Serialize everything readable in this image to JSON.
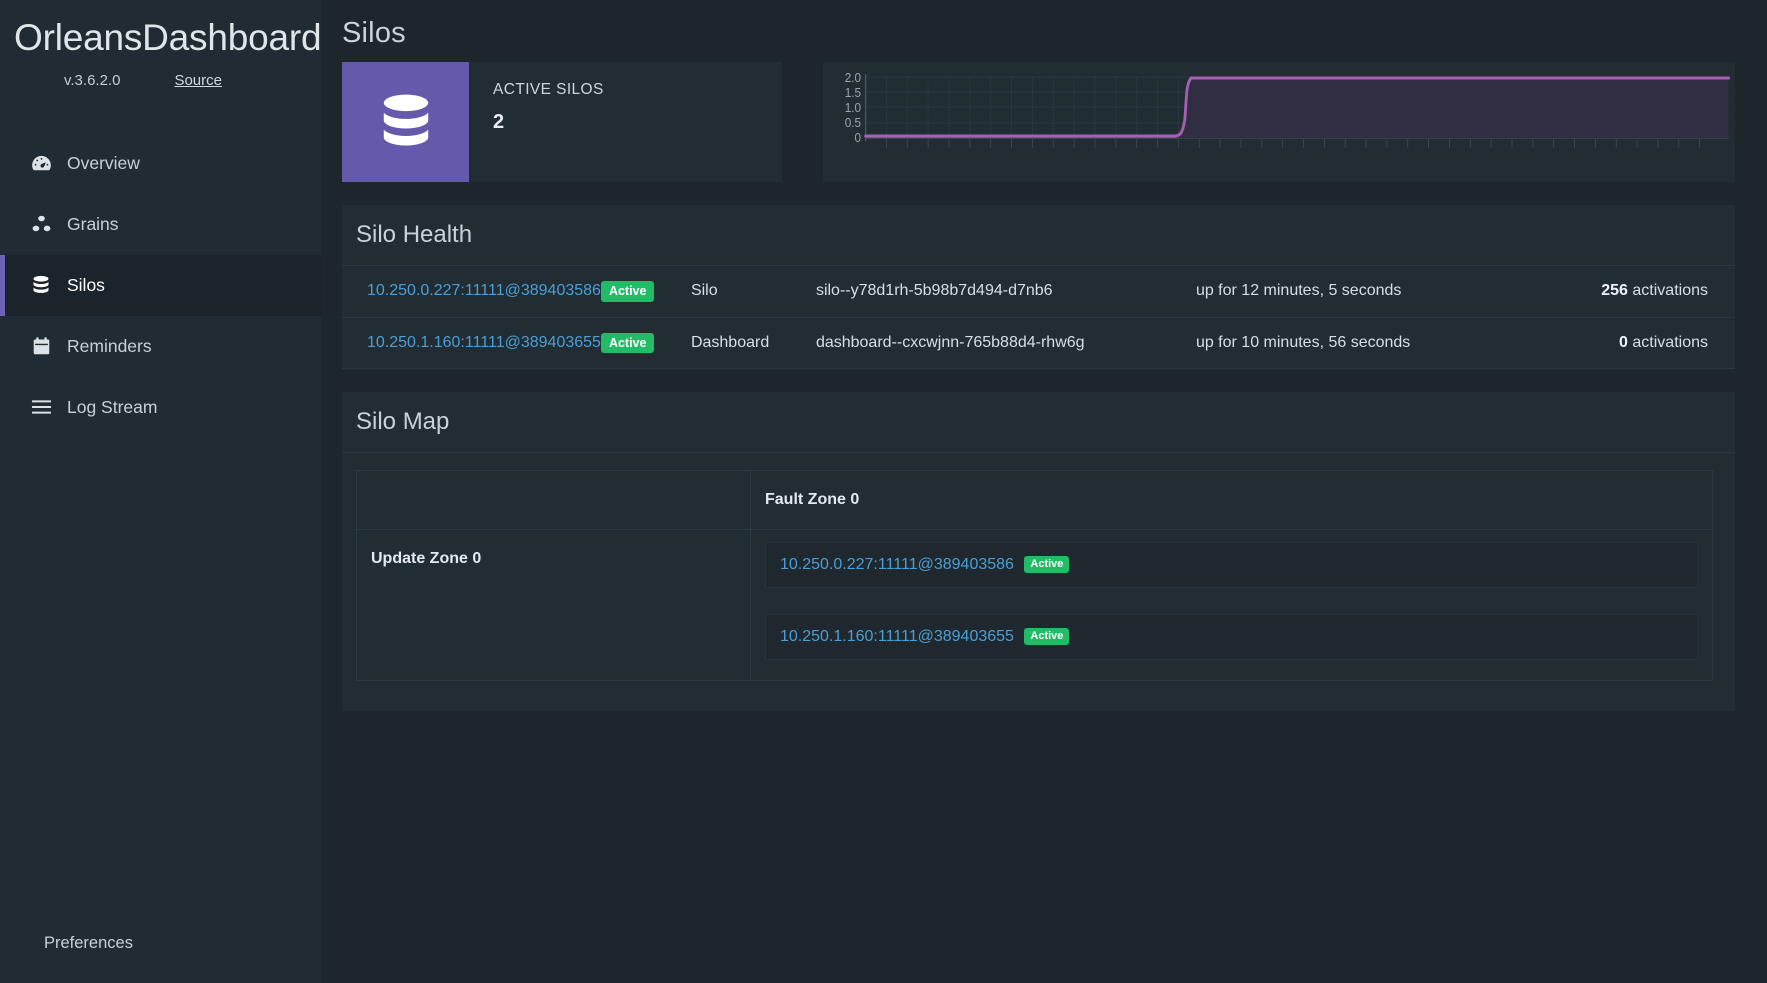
{
  "sidebar": {
    "brand": "OrleansDashboard",
    "version": "v.3.6.2.0",
    "source_link": "Source",
    "items": [
      {
        "label": "Overview",
        "icon": "tachometer-icon",
        "active": false
      },
      {
        "label": "Grains",
        "icon": "cubes-icon",
        "active": false
      },
      {
        "label": "Silos",
        "icon": "database-icon",
        "active": true
      },
      {
        "label": "Reminders",
        "icon": "calendar-icon",
        "active": false
      },
      {
        "label": "Log Stream",
        "icon": "bars-icon",
        "active": false
      }
    ],
    "preferences": "Preferences"
  },
  "page": {
    "title": "Silos"
  },
  "stat_card": {
    "icon": "database-icon",
    "label": "ACTIVE SILOS",
    "value": "2",
    "icon_bg": "#6559ab"
  },
  "chart_data": {
    "type": "line",
    "title": "",
    "xlabel": "",
    "ylabel": "",
    "ytick_labels": [
      "2.0",
      "1.5",
      "1.0",
      "0.5",
      "0"
    ],
    "ytick_values": [
      2.0,
      1.5,
      1.0,
      0.5,
      0
    ],
    "ylim": [
      0,
      2.0
    ],
    "grid": true,
    "legend": "none",
    "series": [
      {
        "name": "active silos",
        "color": "#a65fb4",
        "fill": true,
        "fill_color": "#2e2a3d",
        "x": [
          0,
          40,
          41,
          100
        ],
        "values": [
          0,
          0,
          2,
          2
        ]
      }
    ]
  },
  "silo_health": {
    "title": "Silo Health",
    "rows": [
      {
        "address": "10.250.0.227:11111@389403586",
        "status": "Active",
        "type": "Silo",
        "host": "silo--y78d1rh-5b98b7d494-d7nb6",
        "uptime": "up for 12 minutes, 5 seconds",
        "activations_count": "256",
        "activations_label": "activations"
      },
      {
        "address": "10.250.1.160:11111@389403655",
        "status": "Active",
        "type": "Dashboard",
        "host": "dashboard--cxcwjnn-765b88d4-rhw6g",
        "uptime": "up for 10 minutes, 56 seconds",
        "activations_count": "0",
        "activations_label": "activations"
      }
    ]
  },
  "silo_map": {
    "title": "Silo Map",
    "corner_header": "",
    "fault_zones": [
      "Fault Zone 0"
    ],
    "update_zones": [
      "Update Zone 0"
    ],
    "cells": [
      [
        [
          {
            "address": "10.250.0.227:11111@389403586",
            "status": "Active"
          },
          {
            "address": "10.250.1.160:11111@389403655",
            "status": "Active"
          }
        ]
      ]
    ]
  },
  "colors": {
    "accent_purple": "#6559ab",
    "status_green": "#22bb66",
    "link_blue": "#4b9fd5",
    "panel_bg": "#212c33",
    "page_bg": "#1d262b",
    "sidebar_bg": "#202b33"
  }
}
